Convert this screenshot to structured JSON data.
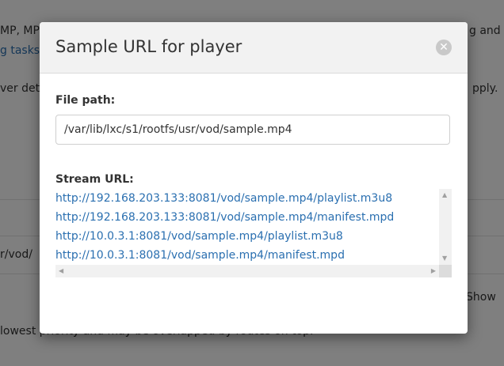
{
  "background": {
    "line1_left": "MP, MP",
    "line1_right": "g and",
    "line2_link": "g tasks",
    "line3_left": "ver det",
    "line3_right": "pply.",
    "line4_left": "r/vod/",
    "line5_right": "Show",
    "line6": "lowest priority and may be overlapped by routes on top."
  },
  "modal": {
    "title": "Sample URL for player",
    "close_icon": "close-icon",
    "file_path_label": "File path:",
    "file_path_value": "/var/lib/lxc/s1/rootfs/usr/vod/sample.mp4",
    "stream_url_label": "Stream URL:",
    "stream_urls": [
      "http://192.168.203.133:8081/vod/sample.mp4/playlist.m3u8",
      "http://192.168.203.133:8081/vod/sample.mp4/manifest.mpd",
      "http://10.0.3.1:8081/vod/sample.mp4/playlist.m3u8",
      "http://10.0.3.1:8081/vod/sample.mp4/manifest.mpd"
    ]
  },
  "colors": {
    "link": "#2a6fb0",
    "header_bg": "#f2f2f2",
    "overlay": "rgba(0,0,0,0.5)"
  }
}
